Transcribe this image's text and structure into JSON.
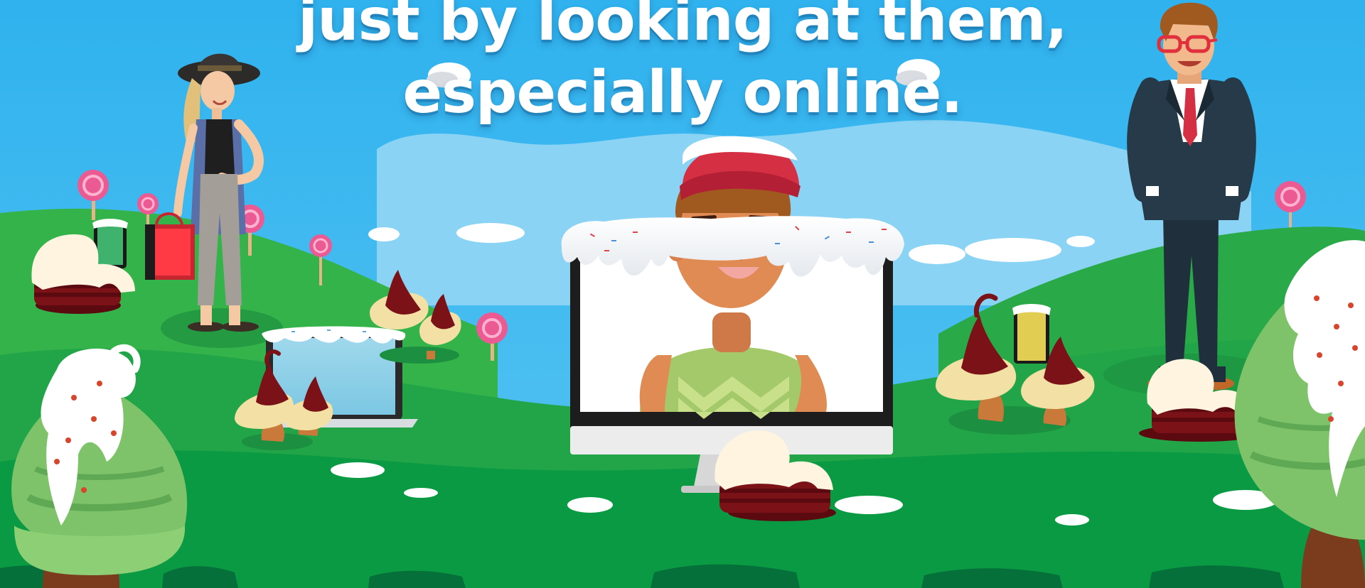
{
  "caption": {
    "line1": "just by looking at them,",
    "line2": "especially online."
  },
  "colors": {
    "sky": "#31b4ef",
    "grass_light": "#34b34a",
    "grass_dark": "#0a9a43",
    "grass_deep": "#04683a",
    "icing": "#ffffff",
    "chocolate": "#6a0f14",
    "lollipop": "#ec5a93",
    "cap_red": "#d42f43",
    "shirt_green": "#a4c96b",
    "suit_navy": "#1f2f3c"
  },
  "icons": {
    "woman": "shopping-woman-illustration",
    "man": "businessman-illustration",
    "monitor": "desktop-monitor-icon",
    "laptop": "laptop-icon",
    "phone": "phone-icon"
  }
}
